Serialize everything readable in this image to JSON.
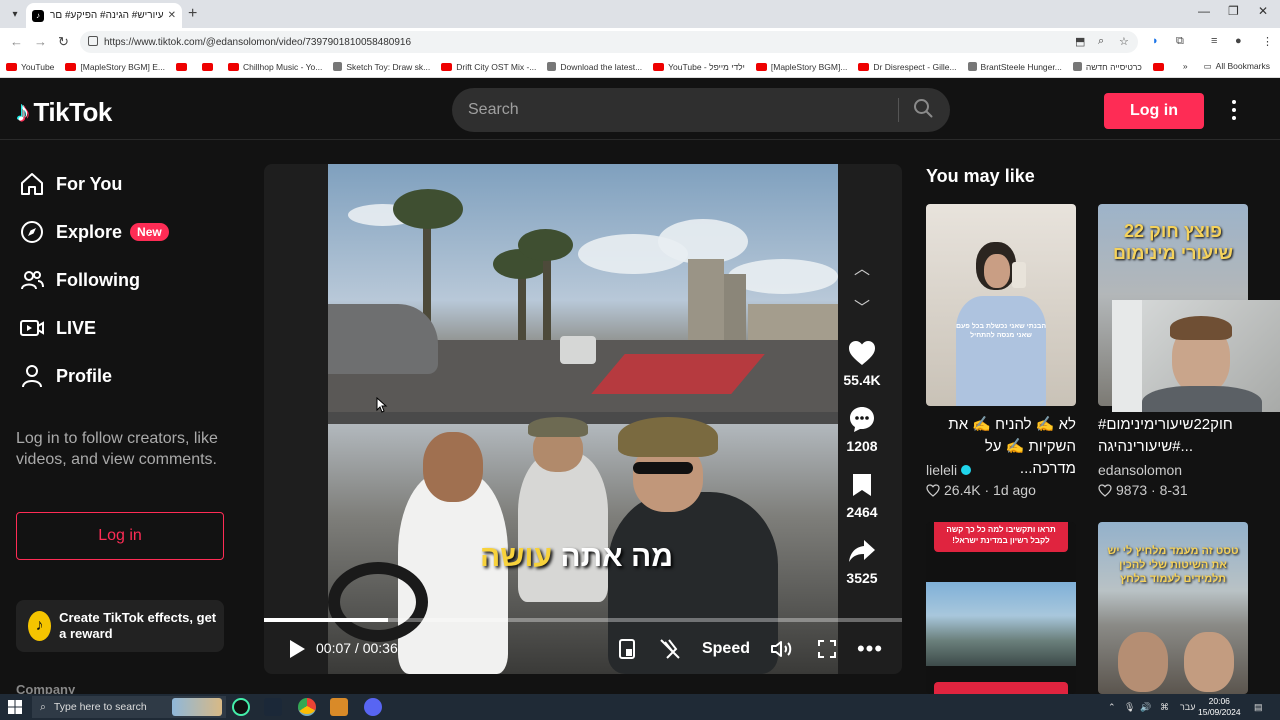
{
  "browser": {
    "tab_title": "עיוריש# הגינה# הפיקע# םרע#",
    "url": "https://www.tiktok.com/@edansolomon/video/7397901810058480916",
    "bookmarks": [
      {
        "label": "YouTube",
        "icon": "youtube"
      },
      {
        "label": "[MapleStory BGM] E...",
        "icon": "youtube"
      },
      {
        "label": "",
        "icon": "youtube"
      },
      {
        "label": "",
        "icon": "youtube"
      },
      {
        "label": "Chillhop Music - Yo...",
        "icon": "youtube"
      },
      {
        "label": "Sketch Toy: Draw sk...",
        "icon": "generic"
      },
      {
        "label": "Drift City OST Mix -...",
        "icon": "youtube"
      },
      {
        "label": "Download the latest...",
        "icon": "generic"
      },
      {
        "label": "YouTube - ילדי מייפל",
        "icon": "youtube"
      },
      {
        "label": "[MapleStory BGM]...",
        "icon": "youtube"
      },
      {
        "label": "Dr Disrespect - Gille...",
        "icon": "youtube"
      },
      {
        "label": "BrantSteele Hunger...",
        "icon": "generic"
      },
      {
        "label": "כרטיסייה חדשה",
        "icon": "generic"
      },
      {
        "label": "",
        "icon": "youtube"
      }
    ],
    "all_bookmarks": "All Bookmarks"
  },
  "header": {
    "logo": "TikTok",
    "search_placeholder": "Search",
    "login": "Log in"
  },
  "sidebar": {
    "items": [
      {
        "label": "For You",
        "icon": "home-icon"
      },
      {
        "label": "Explore",
        "icon": "compass-icon",
        "badge": "New"
      },
      {
        "label": "Following",
        "icon": "users-icon"
      },
      {
        "label": "LIVE",
        "icon": "live-icon"
      },
      {
        "label": "Profile",
        "icon": "profile-icon"
      }
    ],
    "login_prompt": "Log in to follow creators, like videos, and view comments.",
    "login_button": "Log in",
    "effects": "Create TikTok effects, get a reward",
    "company": "Company"
  },
  "video": {
    "caption_highlight": "עושה",
    "caption_rest": "מה אתה",
    "likes": "55.4K",
    "comments": "1208",
    "bookmarks": "2464",
    "shares": "3525",
    "time": "00:07 / 00:36",
    "progress": 0.194,
    "speed_label": "Speed"
  },
  "recommendations": {
    "heading": "You may like",
    "cards": [
      {
        "title": "לא ✍️ להניח ✍️ את השקיות ✍️ על מדרכה...",
        "user": "lieleli",
        "verified": true,
        "likes": "26.4K",
        "date": "1d ago",
        "thumb_text": "הבנתי שאני נכשלת בכל פעם שאני מנסה להתחיל"
      },
      {
        "title": "#חוק22שיעורימינימום #שיעורינהיגה...",
        "user": "edansolomon",
        "verified": false,
        "likes": "9873",
        "date": "8-31",
        "thumb_text": "פוצץ חוק 22 שיעורי מינימום"
      },
      {
        "title": "",
        "user": "",
        "thumb_text": "תראו ותקשיבו למה כל כך קשה לקבל רשיון במדינת ישראל!"
      },
      {
        "title": "",
        "user": "",
        "thumb_text": "טסט זה מעמד מלחיץ לי יש את השיטות שלי להכין תלמידים לעמוד בלחץ"
      }
    ]
  },
  "taskbar": {
    "search_placeholder": "Type here to search",
    "lang": "עבר",
    "time": "20:06",
    "date": "15/09/2024"
  }
}
